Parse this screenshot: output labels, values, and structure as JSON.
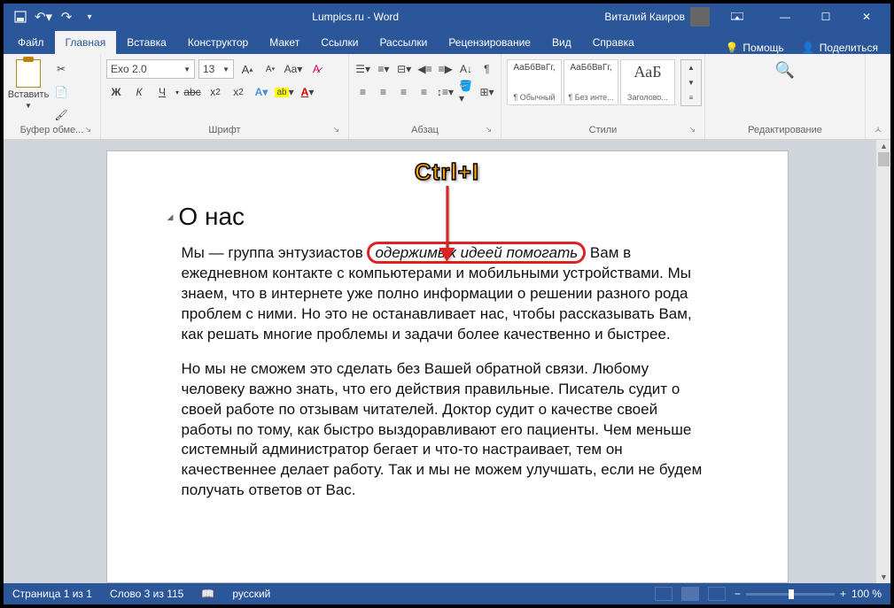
{
  "titlebar": {
    "title": "Lumpics.ru - Word",
    "user": "Виталий Каиров"
  },
  "tabs": {
    "file": "Файл",
    "home": "Главная",
    "insert": "Вставка",
    "design": "Конструктор",
    "layout": "Макет",
    "references": "Ссылки",
    "mailings": "Рассылки",
    "review": "Рецензирование",
    "view": "Вид",
    "help": "Справка",
    "tellme": "Помощь",
    "share": "Поделиться"
  },
  "ribbon": {
    "clipboard": {
      "label": "Буфер обме...",
      "paste": "Вставить"
    },
    "font": {
      "label": "Шрифт",
      "name": "Exo 2.0",
      "size": "13",
      "bold": "Ж",
      "italic": "К",
      "underline": "Ч"
    },
    "paragraph": {
      "label": "Абзац"
    },
    "styles": {
      "label": "Стили",
      "items": [
        {
          "preview": "АаБбВвГг,",
          "name": "¶ Обычный"
        },
        {
          "preview": "АаБбВвГг,",
          "name": "¶ Без инте..."
        },
        {
          "preview": "АаБ",
          "name": "Заголово..."
        }
      ]
    },
    "editing": {
      "label": "Редактирование"
    }
  },
  "document": {
    "heading": "О нас",
    "p1_a": "Мы — группа энтузиастов ",
    "p1_hi": "одержимых идеей помогать",
    "p1_b": " Вам в ежедневном контакте с компьютерами и мобильными устройствами. Мы знаем, что в интернете уже полно информации о решении разного рода проблем с ними. Но это не останавливает нас, чтобы рассказывать Вам, как решать многие проблемы и задачи более качественно и быстрее.",
    "p2": "Но мы не сможем это сделать без Вашей обратной связи. Любому человеку важно знать, что его действия правильные. Писатель судит о своей работе по отзывам читателей. Доктор судит о качестве своей работы по тому, как быстро выздоравливают его пациенты. Чем меньше системный администратор бегает и что-то настраивает, тем он качественнее делает работу. Так и мы не можем улучшать, если не будем получать ответов от Вас."
  },
  "annotation": {
    "label": "Ctrl+I"
  },
  "statusbar": {
    "page": "Страница 1 из 1",
    "words": "Слово 3 из 115",
    "lang": "русский",
    "zoom": "100 %"
  }
}
